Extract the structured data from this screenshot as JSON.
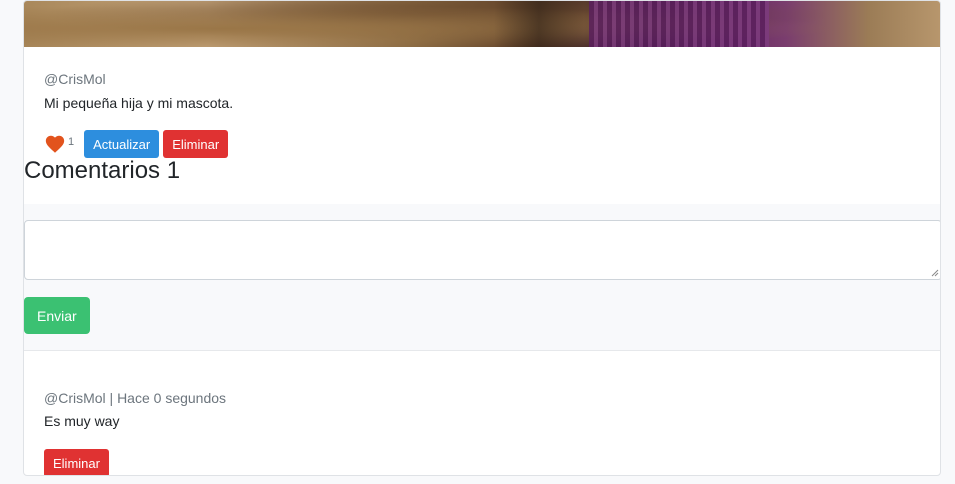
{
  "post": {
    "author": "@CrisMol",
    "description": "Mi pequeña hija y mi mascota.",
    "likes": "1",
    "update_label": "Actualizar",
    "delete_label": "Eliminar"
  },
  "comments": {
    "title": "Comentarios 1",
    "textarea_value": "",
    "send_label": "Enviar",
    "items": [
      {
        "meta": "@CrisMol | Hace 0 segundos",
        "text": "Es muy way",
        "delete_label": "Eliminar"
      }
    ]
  },
  "colors": {
    "like": "#e2531d",
    "update": "#2d8ede",
    "delete": "#e03232",
    "send": "#3bc172"
  },
  "icons": {
    "like": "heart-icon"
  }
}
